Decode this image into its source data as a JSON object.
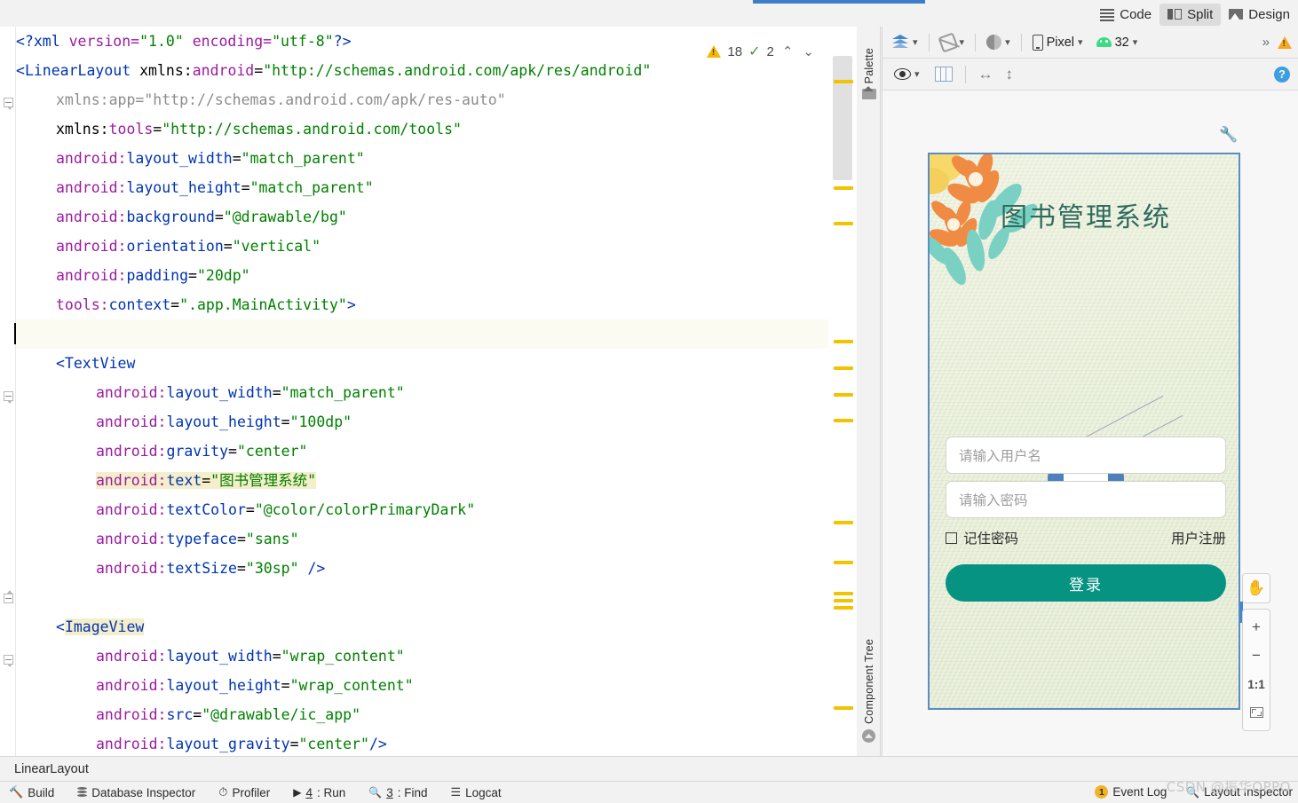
{
  "view_modes": [
    {
      "label": "Code",
      "icon": "code-lines-icon",
      "active": false
    },
    {
      "label": "Split",
      "icon": "split-panes-icon",
      "active": true
    },
    {
      "label": "Design",
      "icon": "design-image-icon",
      "active": false
    }
  ],
  "editor": {
    "inspections": {
      "warning_count": "18",
      "check_count": "2",
      "prev_label": "⌃",
      "next_label": "⌄"
    },
    "lines": [
      {
        "id": "l1",
        "segs": [
          {
            "t": "<?",
            "c": "pun"
          },
          {
            "t": "xml",
            "c": "tag"
          },
          {
            "t": " version=",
            "c": "att"
          },
          {
            "t": "\"1.0\"",
            "c": "val"
          },
          {
            "t": " encoding=",
            "c": "att"
          },
          {
            "t": "\"utf-8\"",
            "c": "val"
          },
          {
            "t": "?>",
            "c": "pun"
          }
        ],
        "indent": 0
      },
      {
        "id": "l2",
        "segs": [
          {
            "t": "<",
            "c": "pun"
          },
          {
            "t": "LinearLayout",
            "c": "tag"
          },
          {
            "t": " xmlns:",
            "c": "blk"
          },
          {
            "t": "android",
            "c": "att"
          },
          {
            "t": "=",
            "c": "blk"
          },
          {
            "t": "\"http://schemas.android.com/apk/res/android\"",
            "c": "val"
          }
        ],
        "indent": 0
      },
      {
        "id": "l3",
        "segs": [
          {
            "t": "xmlns:app=\"http://schemas.android.com/apk/res-auto\"",
            "c": "dim"
          }
        ],
        "indent": 3
      },
      {
        "id": "l4",
        "segs": [
          {
            "t": "xmlns:",
            "c": "blk"
          },
          {
            "t": "tools",
            "c": "att"
          },
          {
            "t": "=",
            "c": "blk"
          },
          {
            "t": "\"http://schemas.android.com/tools\"",
            "c": "val"
          }
        ],
        "indent": 3
      },
      {
        "id": "l5",
        "segs": [
          {
            "t": "android:",
            "c": "att"
          },
          {
            "t": "layout_width",
            "c": "pun"
          },
          {
            "t": "=",
            "c": "blk"
          },
          {
            "t": "\"match_parent\"",
            "c": "val"
          }
        ],
        "indent": 3
      },
      {
        "id": "l6",
        "segs": [
          {
            "t": "android:",
            "c": "att"
          },
          {
            "t": "layout_height",
            "c": "pun"
          },
          {
            "t": "=",
            "c": "blk"
          },
          {
            "t": "\"match_parent\"",
            "c": "val"
          }
        ],
        "indent": 3
      },
      {
        "id": "l7",
        "segs": [
          {
            "t": "android:",
            "c": "att"
          },
          {
            "t": "background",
            "c": "pun"
          },
          {
            "t": "=",
            "c": "blk"
          },
          {
            "t": "\"@drawable/bg\"",
            "c": "val"
          }
        ],
        "indent": 3
      },
      {
        "id": "l8",
        "segs": [
          {
            "t": "android:",
            "c": "att"
          },
          {
            "t": "orientation",
            "c": "pun"
          },
          {
            "t": "=",
            "c": "blk"
          },
          {
            "t": "\"vertical\"",
            "c": "val"
          }
        ],
        "indent": 3
      },
      {
        "id": "l9",
        "segs": [
          {
            "t": "android:",
            "c": "att"
          },
          {
            "t": "padding",
            "c": "pun"
          },
          {
            "t": "=",
            "c": "blk"
          },
          {
            "t": "\"20dp\"",
            "c": "val"
          }
        ],
        "indent": 3
      },
      {
        "id": "l10",
        "segs": [
          {
            "t": "tools:",
            "c": "att"
          },
          {
            "t": "context",
            "c": "pun"
          },
          {
            "t": "=",
            "c": "blk"
          },
          {
            "t": "\".app.MainActivity\"",
            "c": "val"
          },
          {
            "t": ">",
            "c": "pun"
          }
        ],
        "indent": 3
      },
      {
        "id": "l11",
        "segs": [],
        "indent": 0,
        "current": true
      },
      {
        "id": "l12",
        "segs": [
          {
            "t": "<",
            "c": "pun"
          },
          {
            "t": "TextView",
            "c": "tag"
          }
        ],
        "indent": 3
      },
      {
        "id": "l13",
        "segs": [
          {
            "t": "android:",
            "c": "att"
          },
          {
            "t": "layout_width",
            "c": "pun"
          },
          {
            "t": "=",
            "c": "blk"
          },
          {
            "t": "\"match_parent\"",
            "c": "val"
          }
        ],
        "indent": 6
      },
      {
        "id": "l14",
        "segs": [
          {
            "t": "android:",
            "c": "att"
          },
          {
            "t": "layout_height",
            "c": "pun"
          },
          {
            "t": "=",
            "c": "blk"
          },
          {
            "t": "\"100dp\"",
            "c": "val"
          }
        ],
        "indent": 6
      },
      {
        "id": "l15",
        "segs": [
          {
            "t": "android:",
            "c": "att"
          },
          {
            "t": "gravity",
            "c": "pun"
          },
          {
            "t": "=",
            "c": "blk"
          },
          {
            "t": "\"center\"",
            "c": "val"
          }
        ],
        "indent": 6
      },
      {
        "id": "l16",
        "segs": [
          {
            "t": "android:",
            "c": "att hl"
          },
          {
            "t": "text",
            "c": "pun hl"
          },
          {
            "t": "=",
            "c": "blk hl"
          },
          {
            "t": "\"图书管理系统\"",
            "c": "val hl"
          }
        ],
        "indent": 6
      },
      {
        "id": "l17",
        "segs": [
          {
            "t": "android:",
            "c": "att"
          },
          {
            "t": "textColor",
            "c": "pun"
          },
          {
            "t": "=",
            "c": "blk"
          },
          {
            "t": "\"@color/colorPrimaryDark\"",
            "c": "val"
          }
        ],
        "indent": 6
      },
      {
        "id": "l18",
        "segs": [
          {
            "t": "android:",
            "c": "att"
          },
          {
            "t": "typeface",
            "c": "pun"
          },
          {
            "t": "=",
            "c": "blk"
          },
          {
            "t": "\"sans\"",
            "c": "val"
          }
        ],
        "indent": 6
      },
      {
        "id": "l19",
        "segs": [
          {
            "t": "android:",
            "c": "att"
          },
          {
            "t": "textSize",
            "c": "pun"
          },
          {
            "t": "=",
            "c": "blk"
          },
          {
            "t": "\"30sp\"",
            "c": "val"
          },
          {
            "t": " />",
            "c": "pun"
          }
        ],
        "indent": 6
      },
      {
        "id": "l20",
        "segs": [],
        "indent": 0
      },
      {
        "id": "l21",
        "segs": [
          {
            "t": "<",
            "c": "pun"
          },
          {
            "t": "ImageView",
            "c": "tag tagname-hl"
          }
        ],
        "indent": 3
      },
      {
        "id": "l22",
        "segs": [
          {
            "t": "android:",
            "c": "att"
          },
          {
            "t": "layout_width",
            "c": "pun"
          },
          {
            "t": "=",
            "c": "blk"
          },
          {
            "t": "\"wrap_content\"",
            "c": "val"
          }
        ],
        "indent": 6
      },
      {
        "id": "l23",
        "segs": [
          {
            "t": "android:",
            "c": "att"
          },
          {
            "t": "layout_height",
            "c": "pun"
          },
          {
            "t": "=",
            "c": "blk"
          },
          {
            "t": "\"wrap_content\"",
            "c": "val"
          }
        ],
        "indent": 6
      },
      {
        "id": "l24",
        "segs": [
          {
            "t": "android:",
            "c": "att"
          },
          {
            "t": "src",
            "c": "pun"
          },
          {
            "t": "=",
            "c": "blk"
          },
          {
            "t": "\"@drawable/ic_app\"",
            "c": "val"
          }
        ],
        "indent": 6
      },
      {
        "id": "l25",
        "segs": [
          {
            "t": "android:",
            "c": "att"
          },
          {
            "t": "layout_gravity",
            "c": "pun"
          },
          {
            "t": "=",
            "c": "blk"
          },
          {
            "t": "\"center\"",
            "c": "val"
          },
          {
            "t": "/>",
            "c": "pun"
          }
        ],
        "indent": 6
      }
    ],
    "marker_positions": [
      60,
      180,
      220,
      353,
      383,
      413,
      442,
      557,
      602,
      637,
      645,
      653,
      766
    ]
  },
  "tool_tabs": {
    "palette": "Palette",
    "component_tree": "Component Tree"
  },
  "design_toolbar": {
    "layers_icon": "layers-icon",
    "orientation_icon": "rotate-device-icon",
    "theme_icon": "theme-icon",
    "device_label": "Pixel",
    "device_icon": "phone-icon",
    "api_label": "32",
    "api_icon": "android-robot-icon",
    "overflow_label": "»",
    "warning_icon": "warning-triangle-icon"
  },
  "design_toolbar2": {
    "eye_icon": "eye-visibility-icon",
    "columns_icon": "columns-layout-icon",
    "width_icon": "↔",
    "height_icon": "↕",
    "help_icon": "help-circle-icon"
  },
  "preview": {
    "wrench_icon": "wrench-icon",
    "title": "图书管理系统",
    "book_icon": "open-book-icon",
    "username_placeholder": "请输入用户名",
    "password_placeholder": "请输入密码",
    "remember_label": "记住密码",
    "register_label": "用户注册",
    "login_label": "登录",
    "accent_color": "#069382",
    "title_color": "#2e6b5e",
    "bg_color": "#eaf0dc"
  },
  "zoom_controls": {
    "pan_icon": "hand-pan-icon",
    "zoom_in": "+",
    "zoom_out": "−",
    "actual_size": "1:1",
    "fit_icon": "fit-to-screen-icon"
  },
  "breadcrumb": {
    "text": "LinearLayout"
  },
  "status_bar": {
    "left_items": [
      {
        "label": "Build",
        "icon": "hammer-icon",
        "num": ""
      },
      {
        "label": "Database Inspector",
        "icon": "database-icon",
        "num": ""
      },
      {
        "label": "Profiler",
        "icon": "profiler-icon",
        "num": ""
      },
      {
        "label": ": Run",
        "icon": "play-icon",
        "num": "4"
      },
      {
        "label": ": Find",
        "icon": "magnifier-icon",
        "num": "3"
      },
      {
        "label": "Logcat",
        "icon": "logcat-icon",
        "num": ""
      }
    ],
    "event_log": {
      "count": "1",
      "label": "Event Log"
    },
    "layout_inspector": {
      "label": "Layout Inspector",
      "icon": "layout-inspector-icon"
    }
  },
  "watermark": {
    "text": "CSDN @振华OPPO"
  }
}
